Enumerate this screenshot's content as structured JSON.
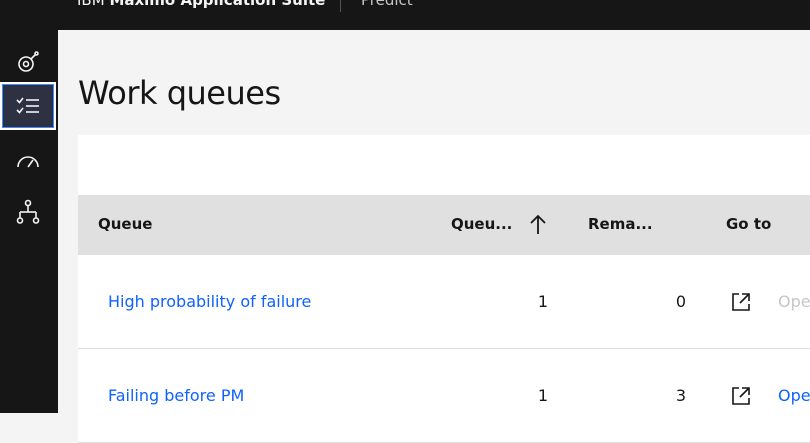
{
  "header": {
    "brand_prefix": "IBM",
    "brand_name": "Maximo Application Suite",
    "app_name": "Predict"
  },
  "sidenav": {
    "items": [
      {
        "icon": "satellite-icon",
        "active": false
      },
      {
        "icon": "checklist-icon",
        "active": true
      },
      {
        "icon": "meter-icon",
        "active": false
      },
      {
        "icon": "hierarchy-icon",
        "active": false
      }
    ]
  },
  "page": {
    "title": "Work queues"
  },
  "table": {
    "columns": {
      "queue": "Queue",
      "queued": "Queu...",
      "remaining": "Rema...",
      "goto": "Go to"
    },
    "rows": [
      {
        "queue": "High probability of failure",
        "queued": "1",
        "remaining": "0",
        "open_label": "Ope",
        "open_enabled": false
      },
      {
        "queue": "Failing before PM",
        "queued": "1",
        "remaining": "3",
        "open_label": "Ope",
        "open_enabled": true
      }
    ]
  },
  "colors": {
    "link": "#0f62fe",
    "disabled": "#c6c6c6",
    "nav_bg": "#161616"
  }
}
